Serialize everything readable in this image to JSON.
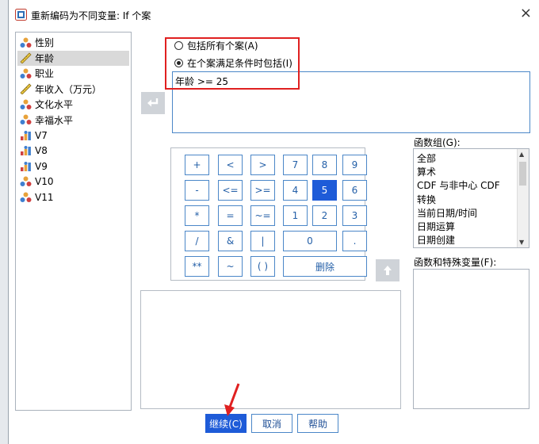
{
  "window": {
    "title": "重新编码为不同变量: If 个案",
    "close_symbol": "×"
  },
  "variables": [
    {
      "label": "性别",
      "type": "nominal",
      "selected": false
    },
    {
      "label": "年龄",
      "type": "scale",
      "selected": true
    },
    {
      "label": "职业",
      "type": "nominal",
      "selected": false
    },
    {
      "label": "年收入（万元）",
      "type": "scale",
      "selected": false
    },
    {
      "label": "文化水平",
      "type": "nominal",
      "selected": false
    },
    {
      "label": "幸福水平",
      "type": "nominal",
      "selected": false
    },
    {
      "label": "V7",
      "type": "ordinal",
      "selected": false
    },
    {
      "label": "V8",
      "type": "ordinal",
      "selected": false
    },
    {
      "label": "V9",
      "type": "ordinal",
      "selected": false
    },
    {
      "label": "V10",
      "type": "nominal",
      "selected": false
    },
    {
      "label": "V11",
      "type": "nominal",
      "selected": false
    }
  ],
  "options": {
    "include_all": "包括所有个案(A)",
    "include_if": "在个案满足条件时包括(I)",
    "selected": "include_if"
  },
  "expression": "年龄 >= 25",
  "keypad": [
    [
      "+",
      "<",
      ">",
      "7",
      "8",
      "9"
    ],
    [
      "-",
      "<=",
      ">=",
      "4",
      "5",
      "6"
    ],
    [
      "*",
      "=",
      "~=",
      "1",
      "2",
      "3"
    ],
    [
      "/",
      "&",
      "|",
      "0",
      "."
    ],
    [
      "**",
      "~",
      "( )",
      "删除"
    ]
  ],
  "keypad_selected": "5",
  "function_group": {
    "label": "函数组(G):",
    "items": [
      "全部",
      "算术",
      "CDF 与非中心 CDF",
      "转换",
      "当前日期/时间",
      "日期运算",
      "日期创建"
    ]
  },
  "functions_label": "函数和特殊变量(F):",
  "buttons": {
    "continue": "继续(C)",
    "cancel": "取消",
    "help": "帮助"
  },
  "colors": {
    "accent": "#1e5bd8",
    "highlight_box": "#e02020"
  }
}
